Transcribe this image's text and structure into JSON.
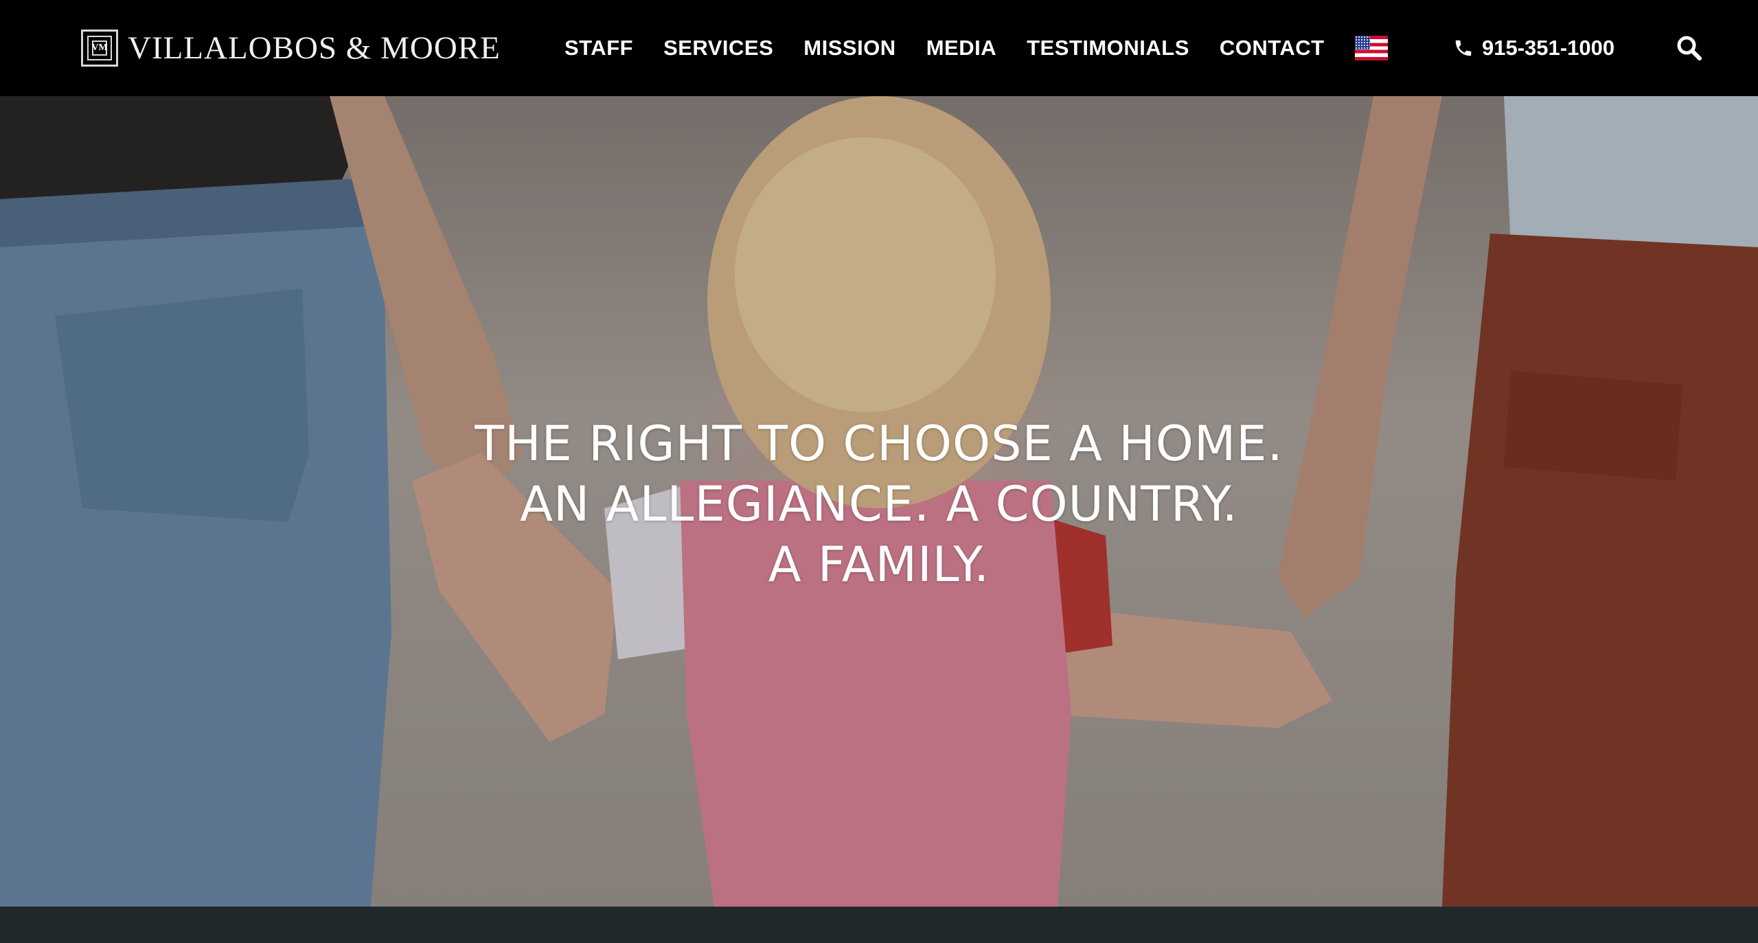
{
  "brand": {
    "name": "VILLALOBOS & MOORE",
    "monogram": "VM"
  },
  "nav": {
    "items": [
      {
        "label": "STAFF"
      },
      {
        "label": "SERVICES"
      },
      {
        "label": "MISSION"
      },
      {
        "label": "MEDIA"
      },
      {
        "label": "TESTIMONIALS"
      },
      {
        "label": "CONTACT"
      }
    ],
    "language_flag": "us-flag-icon"
  },
  "contact": {
    "phone": "915-351-1000",
    "icon": "phone-icon"
  },
  "search": {
    "icon": "search-icon"
  },
  "hero": {
    "lines": [
      "THE RIGHT TO CHOOSE A HOME.",
      "AN ALLEGIANCE. A COUNTRY.",
      "A FAMILY."
    ]
  },
  "colors": {
    "header_bg": "#000000",
    "footer_strip": "#20282c",
    "text": "#ffffff"
  }
}
